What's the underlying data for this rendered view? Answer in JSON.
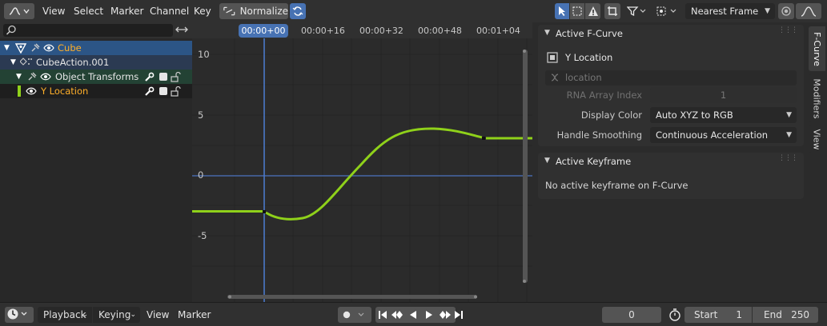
{
  "header": {
    "menus": [
      "View",
      "Select",
      "Marker",
      "Channel",
      "Key"
    ],
    "normalize_label": "Normalize",
    "snap_mode": "Nearest Frame"
  },
  "channels": {
    "search_placeholder": "",
    "items": [
      {
        "label": "Cube",
        "color": "#ffaf29"
      },
      {
        "label": "CubeAction.001",
        "color": "#e6e6e6"
      },
      {
        "label": "Object Transforms",
        "color": "#e6e6e6"
      },
      {
        "label": "Y Location",
        "color": "#ffaf29"
      }
    ]
  },
  "timeline_ruler": {
    "current_frame_label": "00:00+00",
    "ticks": [
      "00:00+16",
      "00:00+32",
      "00:00+48",
      "00:01+04"
    ]
  },
  "graph": {
    "y_ticks": [
      "10",
      "5",
      "0",
      "-5"
    ],
    "curve_color": "#8fd11a"
  },
  "sidebar": {
    "active_fcurve": {
      "title": "Active F-Curve",
      "curve_name": "Y Location",
      "data_path": "location",
      "rna_index_label": "RNA Array Index",
      "rna_index_value": "1",
      "display_color_label": "Display Color",
      "display_color_value": "Auto XYZ to RGB",
      "handle_smoothing_label": "Handle Smoothing",
      "handle_smoothing_value": "Continuous Acceleration"
    },
    "active_keyframe": {
      "title": "Active Keyframe",
      "message": "No active keyframe on F-Curve"
    },
    "tabs": [
      "F-Curve",
      "Modifiers",
      "View"
    ]
  },
  "footer": {
    "playback_label": "Playback",
    "keying_label": "Keying",
    "view_label": "View",
    "marker_label": "Marker",
    "current_frame": "0",
    "start_label": "Start",
    "start_value": "1",
    "end_label": "End",
    "end_value": "250"
  }
}
